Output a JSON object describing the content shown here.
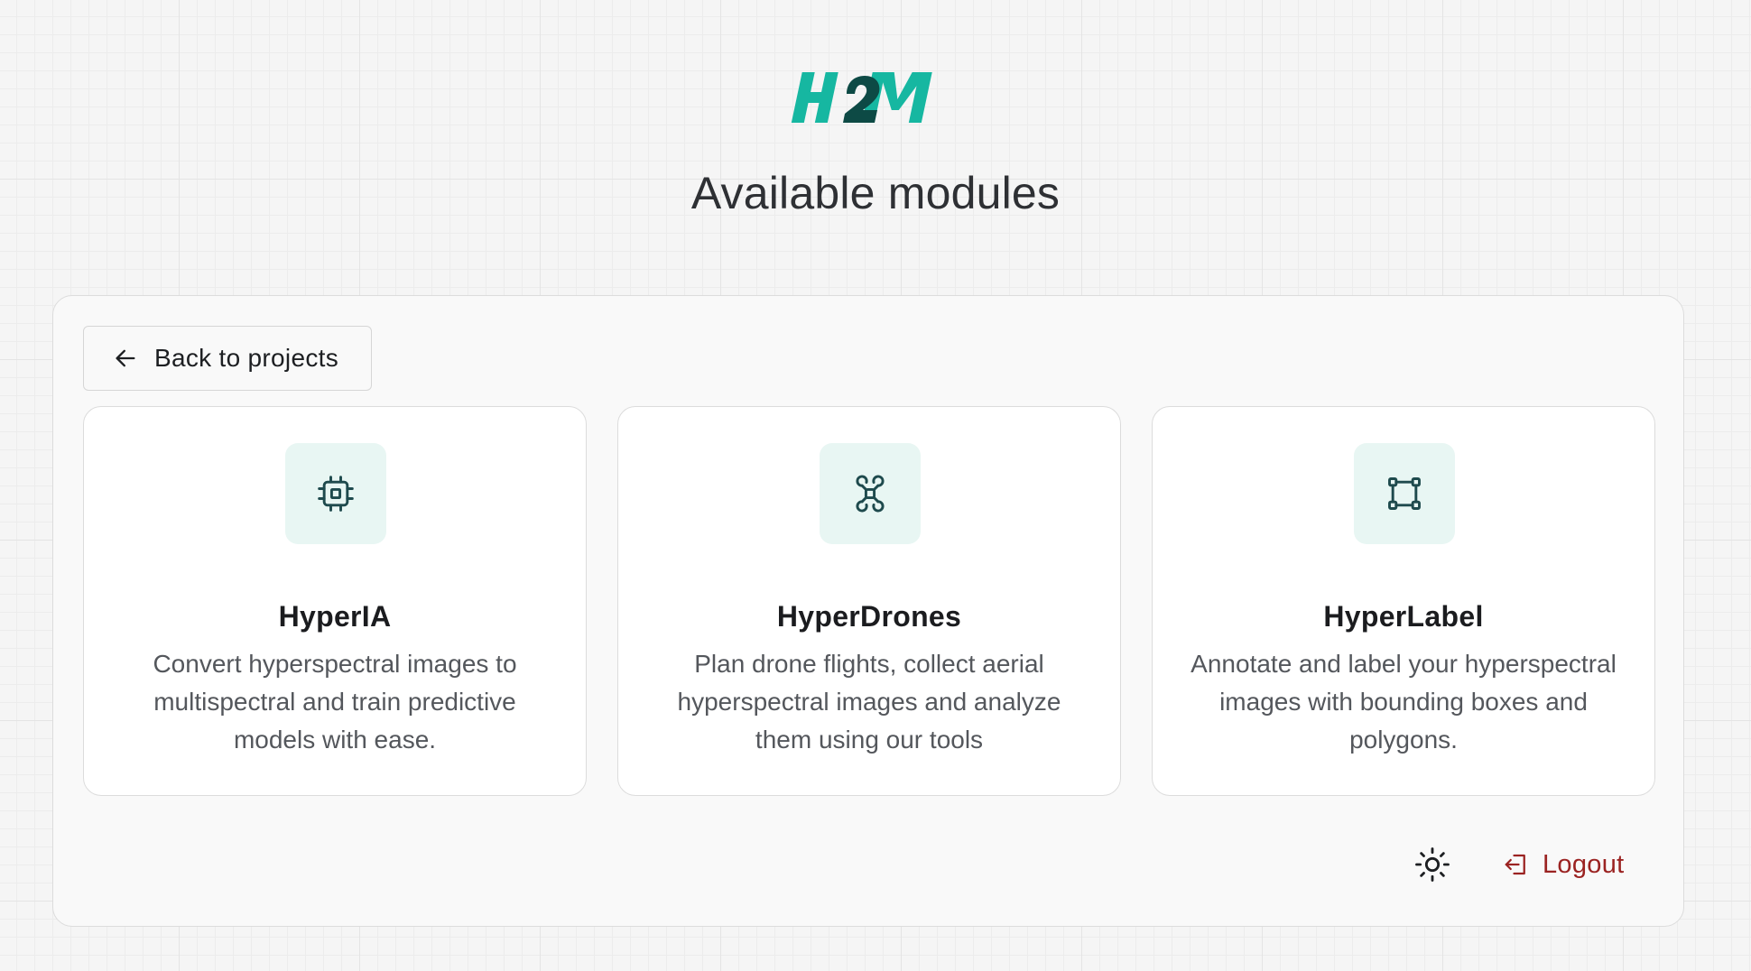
{
  "brand": {
    "logo_text": "H2M",
    "logo_colors": {
      "primary": "#16b7a1",
      "dark": "#0d4a45"
    }
  },
  "header": {
    "title": "Available modules"
  },
  "panel": {
    "back_button_label": "Back to projects",
    "modules": [
      {
        "title": "HyperIA",
        "description": "Convert hyperspectral images to multispectral and train predictive models with ease.",
        "icon": "cpu-chip-icon"
      },
      {
        "title": "HyperDrones",
        "description": "Plan drone flights, collect aerial hyperspectral images and analyze them using our tools",
        "icon": "drone-icon"
      },
      {
        "title": "HyperLabel",
        "description": "Annotate and label your hyperspectral images with bounding boxes and polygons.",
        "icon": "bounding-box-icon"
      }
    ],
    "footer": {
      "theme_toggle_icon": "sun-icon",
      "logout_label": "Logout",
      "logout_icon": "logout-icon",
      "logout_color": "#9b2322"
    }
  },
  "colors": {
    "accent": "#16b7a1",
    "icon_tile_bg": "#e8f6f3",
    "icon_stroke": "#1e4a4d"
  }
}
